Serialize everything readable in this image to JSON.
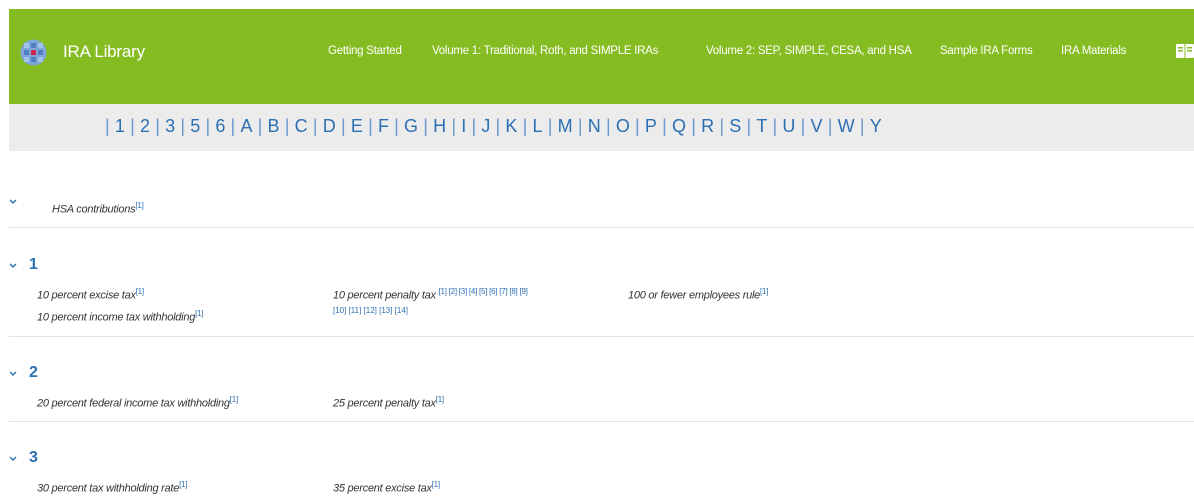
{
  "header": {
    "brand": "IRA Library",
    "nav": [
      {
        "label": "Getting Started"
      },
      {
        "label": "Volume 1: Traditional, Roth, and SIMPLE IRAs"
      },
      {
        "label": "Volume 2: SEP, SIMPLE, CESA, and HSA"
      },
      {
        "label": "Sample IRA Forms"
      },
      {
        "label": "IRA Materials"
      }
    ],
    "icons": [
      "logo-icon",
      "book-icon"
    ],
    "accent_color": "#85bc22"
  },
  "alphabet": [
    "1",
    "2",
    "3",
    "5",
    "6",
    "A",
    "B",
    "C",
    "D",
    "E",
    "F",
    "G",
    "H",
    "I",
    "J",
    "K",
    "L",
    "M",
    "N",
    "O",
    "P",
    "Q",
    "R",
    "S",
    "T",
    "U",
    "V",
    "W",
    "Y"
  ],
  "link_color": "#2c6fb3",
  "sections": {
    "top": {
      "term": "HSA contributions",
      "ref": "[1]"
    },
    "s1": {
      "heading": "1",
      "terms": [
        {
          "label": "10 percent excise tax",
          "ref": "[1]"
        },
        {
          "label": "10 percent income tax withholding",
          "ref": "[1]"
        },
        {
          "label": "10 percent penalty tax",
          "refs_line1": "[1] [2] [3] [4] [5] [6] [7] [8] [9]",
          "refs_line2": "[10] [11] [12] [13] [14]"
        },
        {
          "label": "100 or fewer employees rule",
          "ref": "[1]"
        }
      ]
    },
    "s2": {
      "heading": "2",
      "terms": [
        {
          "label": "20 percent federal income tax withholding",
          "ref": "[1]"
        },
        {
          "label": "25 percent penalty tax",
          "ref": "[1]"
        }
      ]
    },
    "s3": {
      "heading": "3",
      "terms": [
        {
          "label": "30 percent tax withholding rate",
          "ref": "[1]"
        },
        {
          "label": "35 percent excise tax",
          "ref": "[1]"
        }
      ]
    }
  }
}
